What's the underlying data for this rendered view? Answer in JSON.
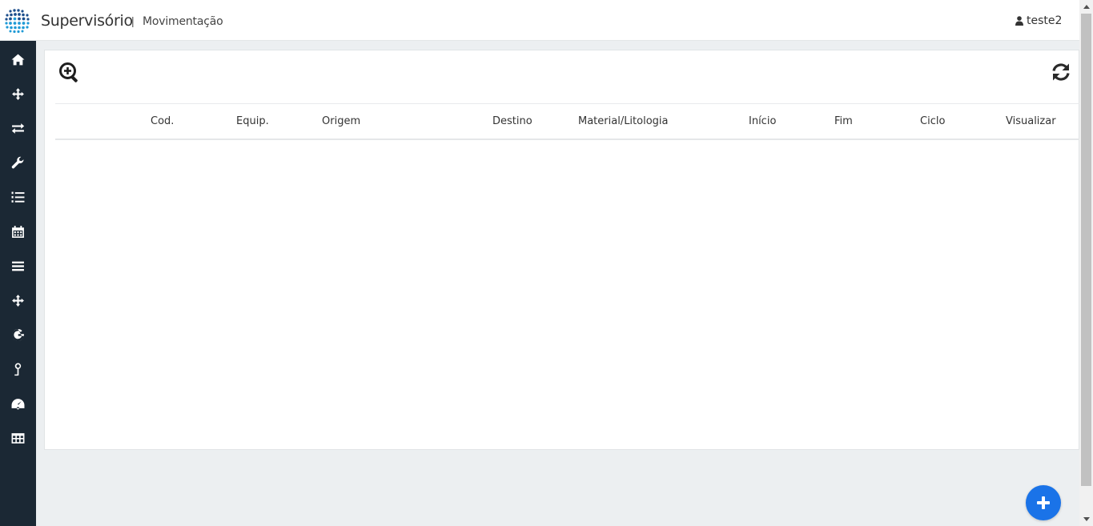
{
  "header": {
    "app_title": "Supervisório",
    "separator": "|",
    "page_name": "Movimentação",
    "user_name": "teste2"
  },
  "sidebar": {
    "items": [
      {
        "icon": "home-icon"
      },
      {
        "icon": "crosshair-icon"
      },
      {
        "icon": "exchange-icon"
      },
      {
        "icon": "wrench-icon"
      },
      {
        "icon": "list-ol-icon"
      },
      {
        "icon": "calendar-icon"
      },
      {
        "icon": "bars-icon"
      },
      {
        "icon": "crosshair-icon"
      },
      {
        "icon": "google-icon"
      },
      {
        "icon": "map-pin-icon"
      },
      {
        "icon": "dashboard-icon"
      },
      {
        "icon": "table-icon"
      }
    ]
  },
  "table": {
    "columns": [
      "Cod.",
      "Equip.",
      "Origem",
      "Destino",
      "Material/Litologia",
      "Início",
      "Fim",
      "Ciclo",
      "Visualizar"
    ]
  },
  "colors": {
    "sidebar_bg": "#1b2834",
    "fab": "#1a73e8",
    "page_bg": "#eceff1"
  }
}
